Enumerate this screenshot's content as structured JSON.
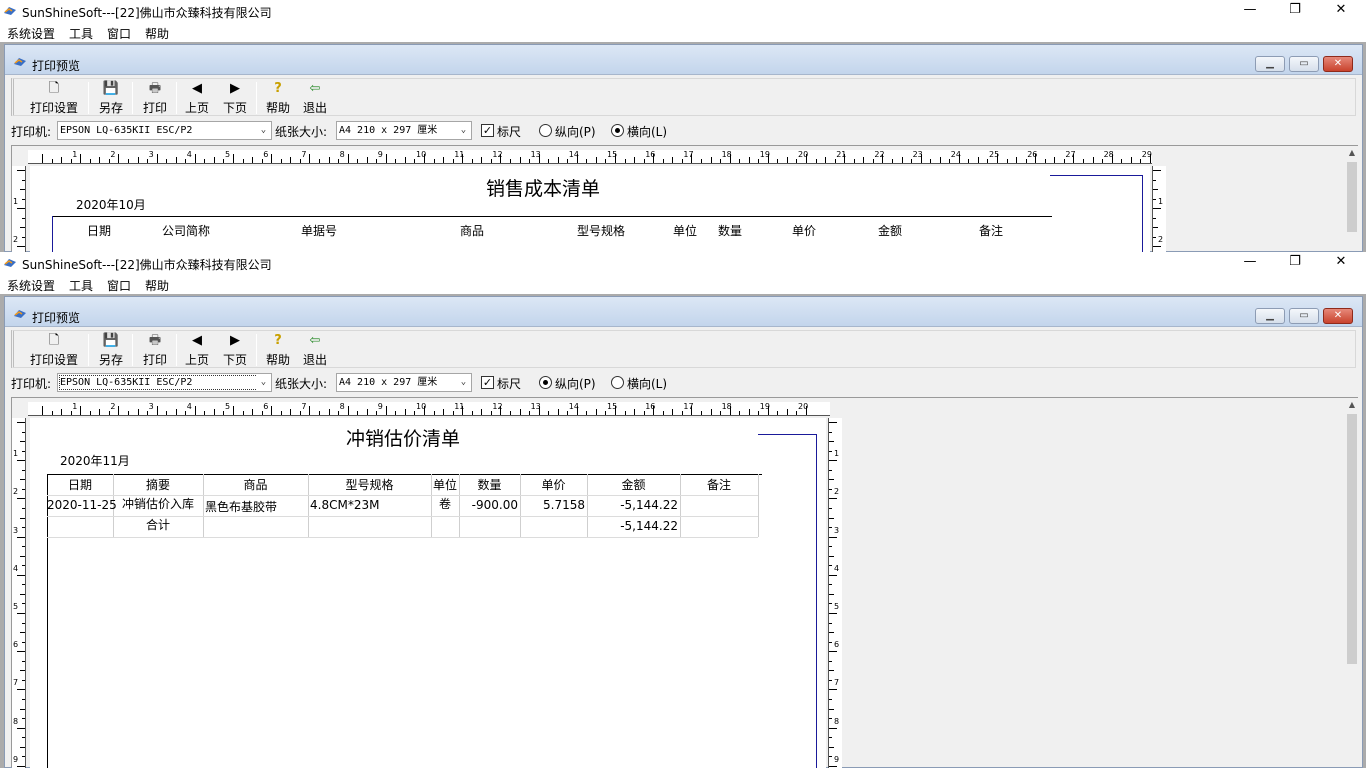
{
  "app": {
    "title": "SunShineSoft---[22]佛山市众臻科技有限公司"
  },
  "menu": [
    "系统设置",
    "工具",
    "窗口",
    "帮助"
  ],
  "child": {
    "title": "打印预览"
  },
  "toolbar": [
    {
      "label": "打印设置",
      "icon": "page-setup-icon",
      "glyph": "🗋"
    },
    {
      "label": "另存",
      "icon": "save-icon",
      "glyph": "💾"
    },
    {
      "label": "打印",
      "icon": "printer-icon",
      "glyph": "🖶"
    },
    {
      "label": "上页",
      "icon": "prev-page-icon",
      "glyph": "◀"
    },
    {
      "label": "下页",
      "icon": "next-page-icon",
      "glyph": "▶"
    },
    {
      "label": "帮助",
      "icon": "help-icon",
      "glyph": "?"
    },
    {
      "label": "退出",
      "icon": "exit-icon",
      "glyph": "⇦"
    }
  ],
  "options": {
    "printer_label": "打印机:",
    "printer_value": "EPSON LQ-635KII ESC/P2",
    "paper_label": "纸张大小:",
    "paper_value": "A4 210 x 297 厘米",
    "ruler_label": "标尺",
    "portrait_label": "纵向(P)",
    "landscape_label": "横向(L)"
  },
  "window1": {
    "orientation": "landscape",
    "report_title": "销售成本清单",
    "month": "2020年10月",
    "headers": [
      "日期",
      "公司简称",
      "单据号",
      "商品",
      "型号规格",
      "单位",
      "数量",
      "单价",
      "金额",
      "备注"
    ],
    "ruler_h": [
      "1",
      "2",
      "3",
      "4",
      "5",
      "6",
      "7",
      "8",
      "9",
      "10",
      "11",
      "12",
      "13",
      "14",
      "15",
      "16",
      "17",
      "18",
      "19",
      "20",
      "21",
      "22",
      "23",
      "24",
      "25",
      "26",
      "27",
      "28",
      "29"
    ],
    "ruler_v": [
      "1",
      "2"
    ]
  },
  "window2": {
    "orientation": "portrait",
    "report_title": "冲销估价清单",
    "month": "2020年11月",
    "headers": [
      "日期",
      "摘要",
      "商品",
      "型号规格",
      "单位",
      "数量",
      "单价",
      "金额",
      "备注"
    ],
    "rows": [
      [
        "2020-11-25",
        "冲销估价入库",
        "黑色布基胶带",
        "4.8CM*23M",
        "卷",
        "-900.00",
        "5.7158",
        "-5,144.22",
        ""
      ],
      [
        "",
        "合计",
        "",
        "",
        "",
        "",
        "",
        "-5,144.22",
        ""
      ]
    ],
    "ruler_h": [
      "1",
      "2",
      "3",
      "4",
      "5",
      "6",
      "7",
      "8",
      "9",
      "10",
      "11",
      "12",
      "13",
      "14",
      "15",
      "16",
      "17",
      "18",
      "19",
      "20"
    ],
    "ruler_v": [
      "1",
      "2",
      "3",
      "4",
      "5",
      "6",
      "7",
      "8",
      "9"
    ]
  },
  "colors": {
    "mdi_bg": "#ababab",
    "child_title": "#c9d9ee",
    "close_red": "#c9432d",
    "frame_blue": "#1a1a9a"
  }
}
